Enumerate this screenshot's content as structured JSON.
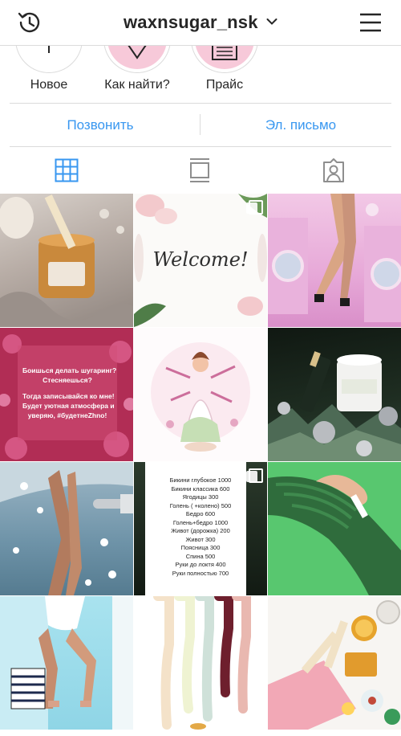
{
  "header": {
    "username": "waxnsugar_nsk",
    "left_icon": "history-icon",
    "right_icon": "menu-icon",
    "chevron_icon": "chevron-down-icon"
  },
  "highlights": [
    {
      "label": "Новое"
    },
    {
      "label": "Как найти?"
    },
    {
      "label": "Прайс"
    }
  ],
  "contacts": {
    "call": "Позвонить",
    "email": "Эл. письмо"
  },
  "tabs": [
    {
      "icon": "grid-icon",
      "active": true
    },
    {
      "icon": "feed-icon",
      "active": false
    },
    {
      "icon": "tagged-icon",
      "active": false
    }
  ],
  "posts": {
    "p2_text": "Welcome!",
    "p4_lines": [
      "Боишься делать шугаринг?",
      "Стесняешься?",
      "",
      "Тогда записывайся ко мне!",
      "Будет уютная атмосфера и",
      "уверяю, #будетнеZhno!"
    ],
    "p8_lines": [
      "Бикини глубокое 1000",
      "Бикини классика 600",
      "Ягодицы 300",
      "Голень ( +колено) 500",
      "Бедро 600",
      "Голень+бедро 1000",
      "Живот (дорожка) 200",
      "Живот 300",
      "Поясница 300",
      "Спина 500",
      "Руки до локтя 400",
      "Руки полностью 700"
    ]
  },
  "colors": {
    "accent": "#3897f0",
    "border": "#dbdbdb",
    "text": "#262626"
  }
}
